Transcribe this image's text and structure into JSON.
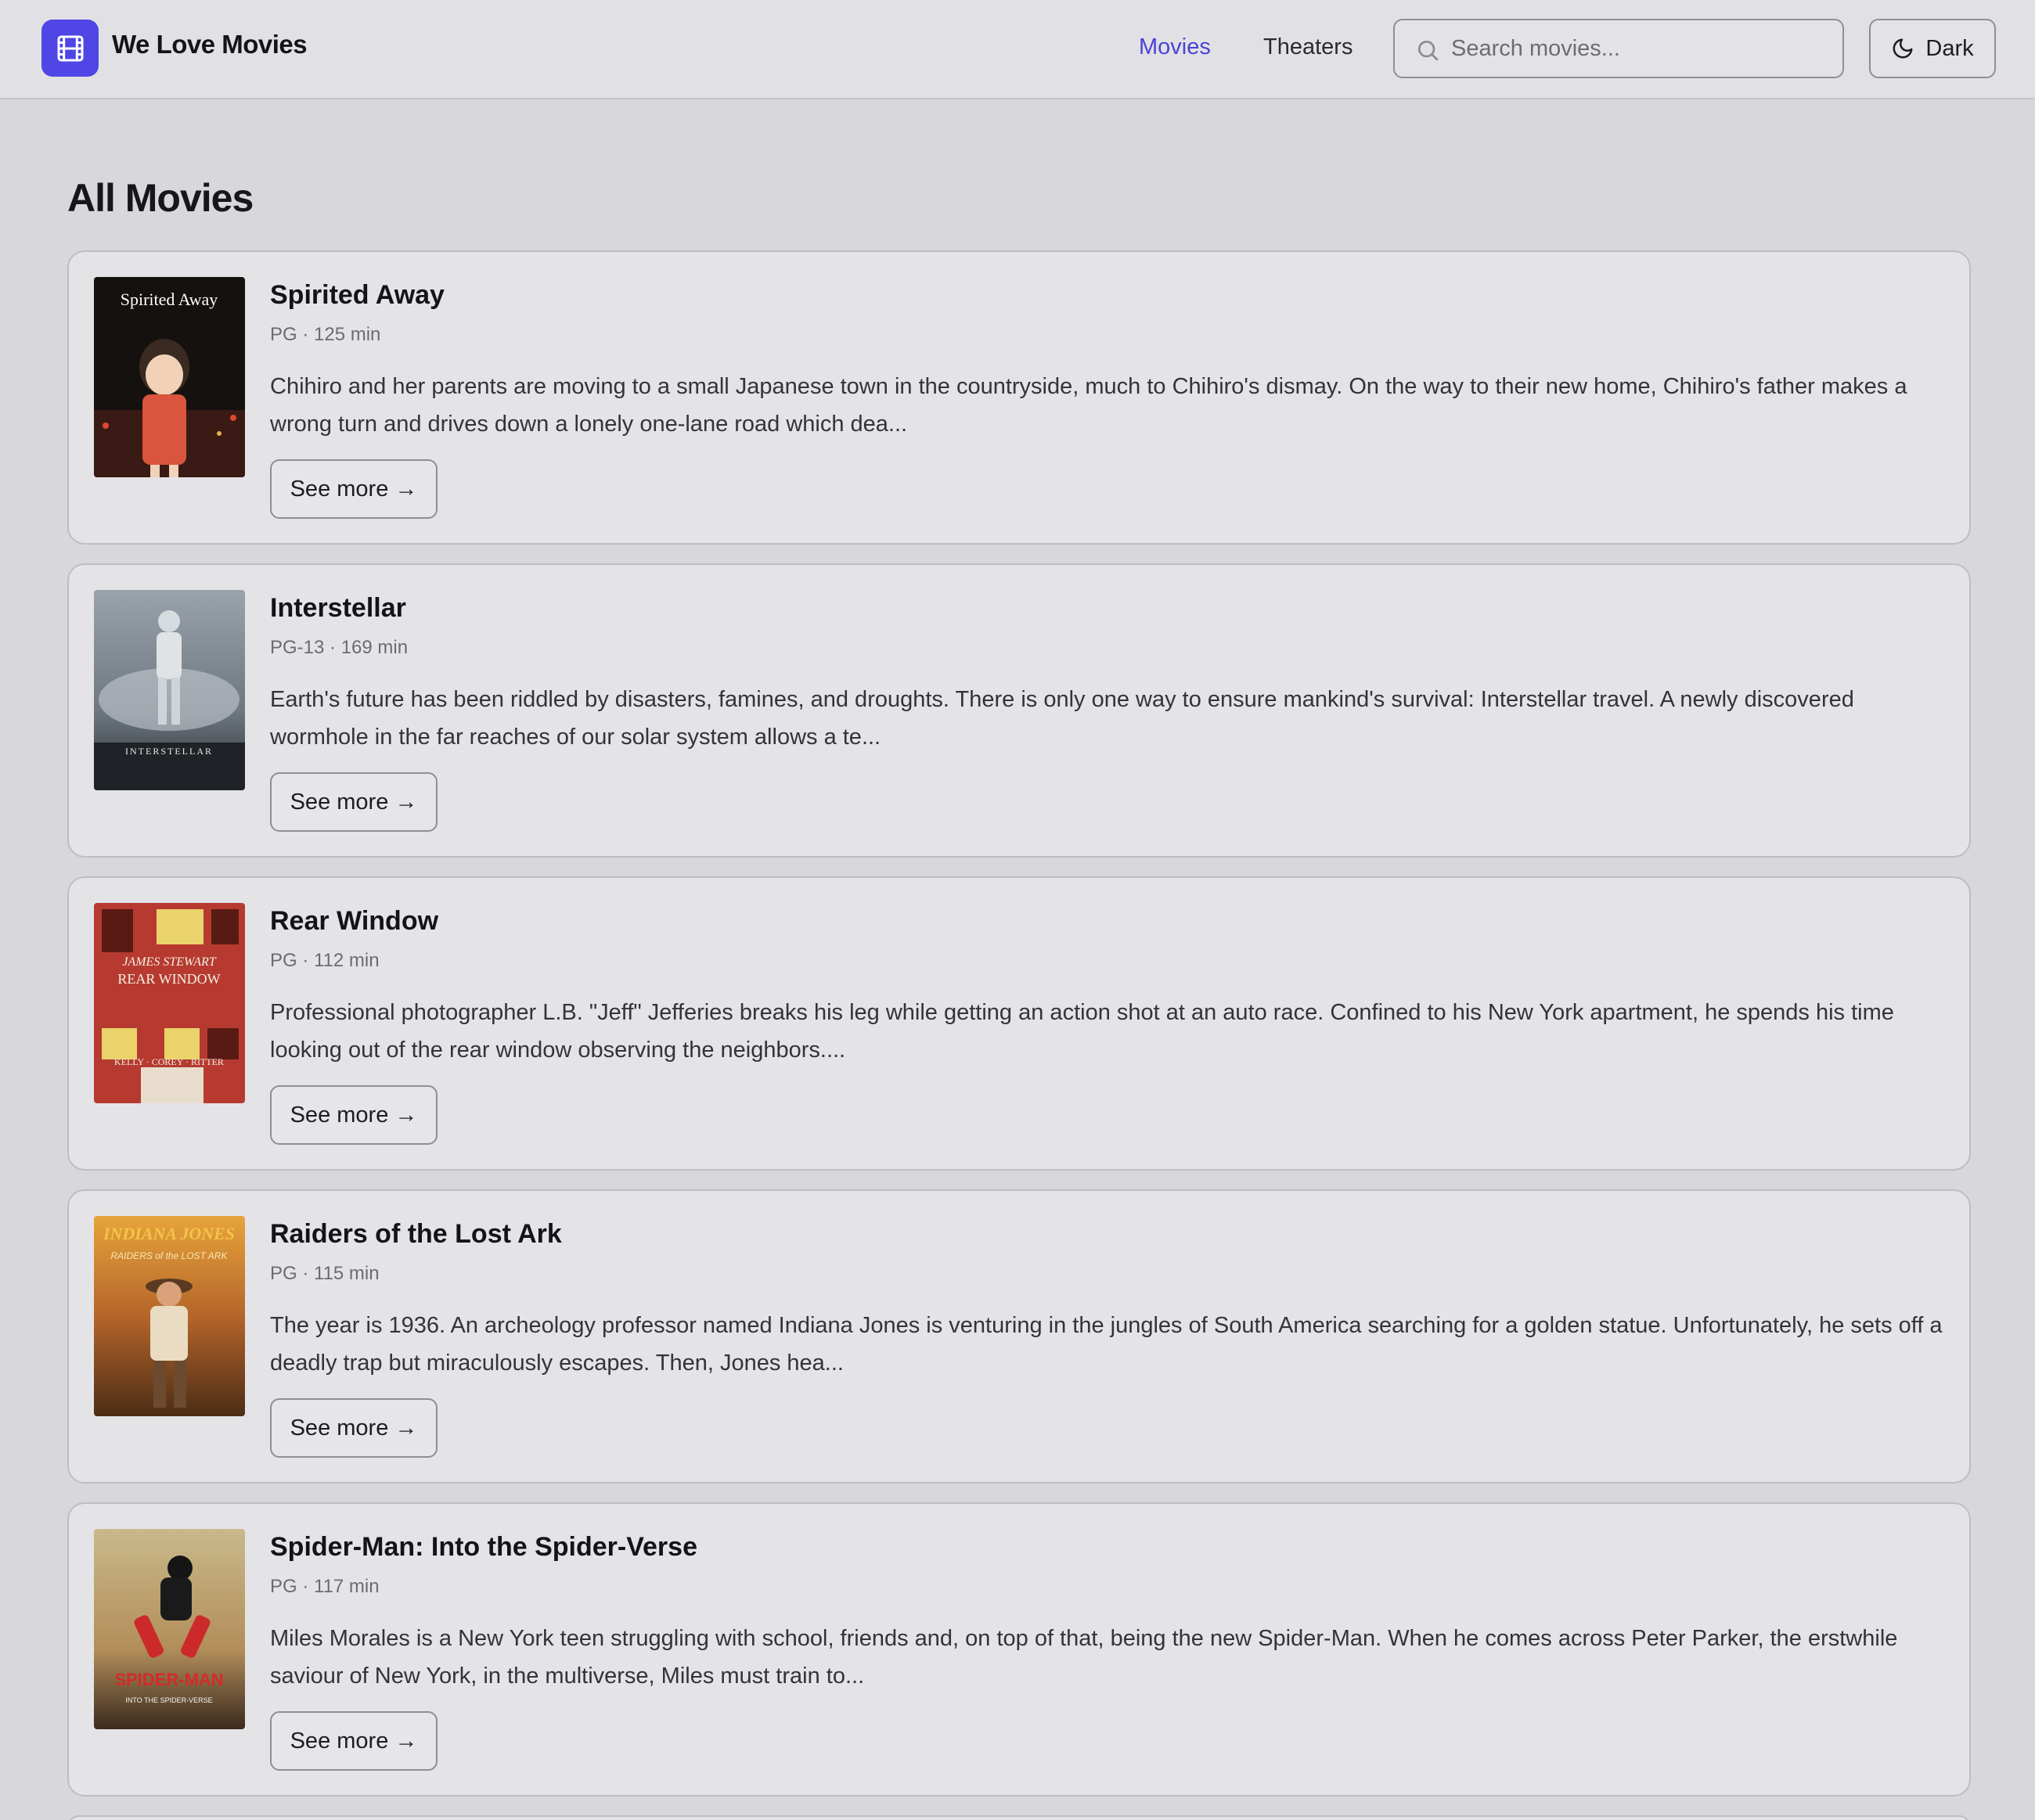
{
  "header": {
    "brand": "We Love Movies",
    "logo_icon": "film-icon",
    "nav": [
      {
        "label": "Movies",
        "active": true
      },
      {
        "label": "Theaters",
        "active": false
      }
    ],
    "search": {
      "placeholder": "Search movies...",
      "value": ""
    },
    "theme_toggle": {
      "label": "Dark",
      "icon": "moon-icon"
    },
    "accent_color": "#4f46e5"
  },
  "main": {
    "title": "All Movies",
    "see_more_label": "See more →",
    "movies": [
      {
        "title": "Spirited Away",
        "meta": "PG · 125 min",
        "description": "Chihiro and her parents are moving to a small Japanese town in the countryside, much to Chihiro's dismay. On the way to their new home, Chihiro's father makes a wrong turn and drives down a lonely one-lane road which dea...",
        "poster_text": "Spirited Away"
      },
      {
        "title": "Interstellar",
        "meta": "PG-13 · 169 min",
        "description": "Earth's future has been riddled by disasters, famines, and droughts. There is only one way to ensure mankind's survival: Interstellar travel. A newly discovered wormhole in the far reaches of our solar system allows a te...",
        "poster_text": "INTERSTELLAR"
      },
      {
        "title": "Rear Window",
        "meta": "PG · 112 min",
        "description": "Professional photographer L.B. \"Jeff\" Jefferies breaks his leg while getting an action shot at an auto race. Confined to his New York apartment, he spends his time looking out of the rear window observing the neighbors....",
        "poster_text": "REAR WINDOW"
      },
      {
        "title": "Raiders of the Lost Ark",
        "meta": "PG · 115 min",
        "description": "The year is 1936. An archeology professor named Indiana Jones is venturing in the jungles of South America searching for a golden statue. Unfortunately, he sets off a deadly trap but miraculously escapes. Then, Jones hea...",
        "poster_text": "INDIANA JONES"
      },
      {
        "title": "Spider-Man: Into the Spider-Verse",
        "meta": "PG · 117 min",
        "description": "Miles Morales is a New York teen struggling with school, friends and, on top of that, being the new Spider-Man. When he comes across Peter Parker, the erstwhile saviour of New York, in the multiverse, Miles must train to...",
        "poster_text": "SPIDER-MAN"
      }
    ]
  }
}
